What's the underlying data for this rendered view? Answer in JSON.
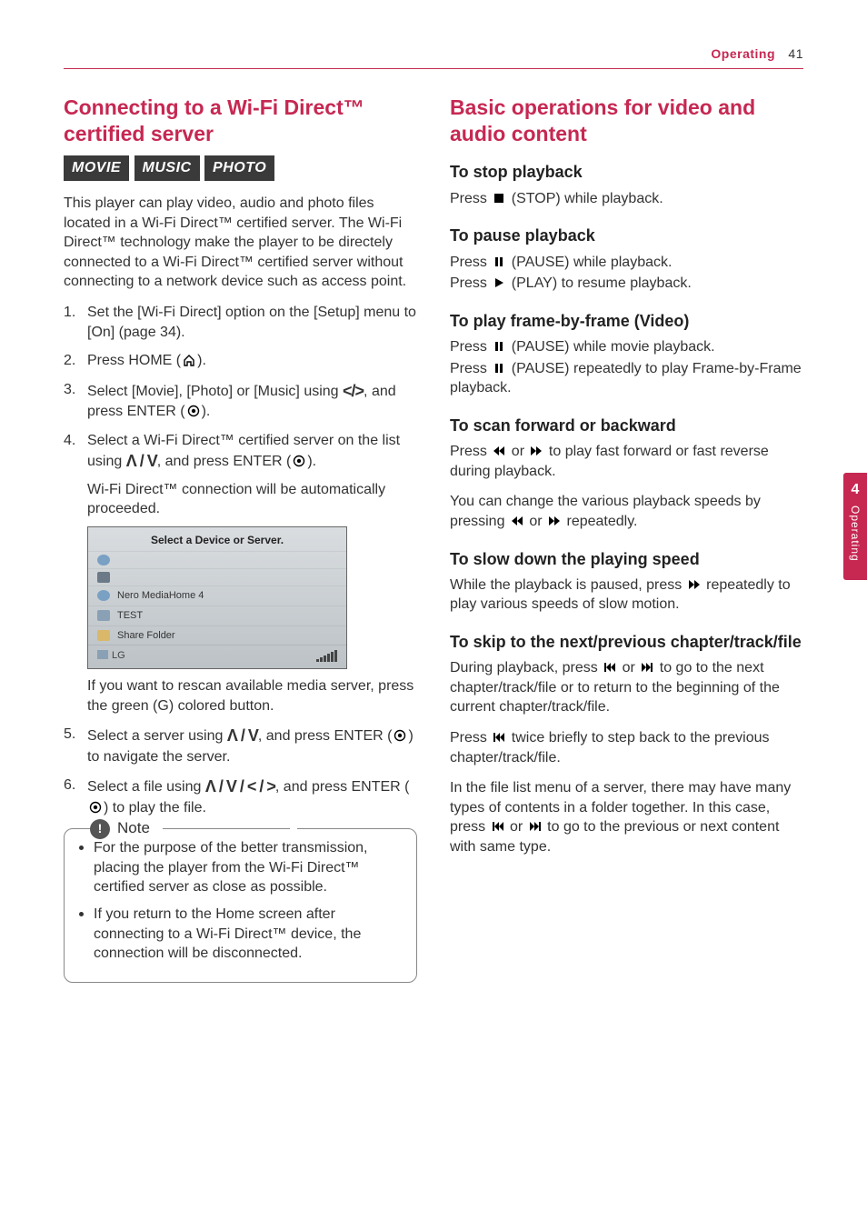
{
  "header": {
    "section": "Operating",
    "page": "41"
  },
  "sidetab": {
    "number": "4",
    "label": "Operating"
  },
  "left": {
    "title": "Connecting to a Wi-Fi Direct™ certified server",
    "chips": [
      "MOVIE",
      "MUSIC",
      "PHOTO"
    ],
    "intro": "This player can play video, audio and photo files located in a Wi-Fi Direct™ certified server. The Wi-Fi Direct™ technology make the player to be directely connected to a Wi-Fi Direct™ certified server without connecting to a network device such as access point.",
    "steps": {
      "s1": "Set the [Wi-Fi Direct] option on the [Setup] menu to [On] (page 34).",
      "s2a": "Press HOME (",
      "s2b": ").",
      "s3a": "Select [Movie], [Photo] or [Music] using ",
      "s3b": ", and press ENTER (",
      "s3c": ").",
      "s4a": "Select a Wi-Fi Direct™ certified server on the list using ",
      "s4b": ", and press ENTER (",
      "s4c": ").",
      "s4_sub": "Wi-Fi Direct™ connection will be automatically proceeded.",
      "s4_after": "If you want to rescan available media server, press the green (G) colored button.",
      "s5a": "Select a server using ",
      "s5b": ", and press ENTER (",
      "s5c": ") to navigate the server.",
      "s6a": "Select a file using ",
      "s6b": ", and press ENTER (",
      "s6c": ") to play the file."
    },
    "screenshot": {
      "title": "Select a Device or Server.",
      "rows": [
        "",
        "",
        "Nero MediaHome 4",
        "TEST",
        "Share Folder"
      ],
      "footer_left": "LG"
    },
    "note": {
      "label": "Note",
      "items": [
        "For the purpose of the better transmission, placing the player from the Wi-Fi Direct™ certified server as close as possible.",
        "If you return to the Home screen after connecting to a Wi-Fi Direct™ device, the connection will be disconnected."
      ]
    }
  },
  "right": {
    "title": "Basic operations for video and audio content",
    "stop": {
      "h": "To stop playback",
      "p1a": "Press ",
      "p1b": " (STOP) while playback."
    },
    "pause": {
      "h": "To pause playback",
      "p1a": "Press ",
      "p1b": " (PAUSE) while playback.",
      "p2a": "Press ",
      "p2b": " (PLAY) to resume playback."
    },
    "frame": {
      "h": "To play frame-by-frame (Video)",
      "p1a": "Press ",
      "p1b": " (PAUSE) while movie playback.",
      "p2a": "Press ",
      "p2b": " (PAUSE) repeatedly to play Frame-by-Frame playback."
    },
    "scan": {
      "h": "To scan forward or backward",
      "p1a": "Press ",
      "p1b": " or ",
      "p1c": " to play fast forward or fast reverse during playback.",
      "p2a": "You can change the various playback speeds by pressing ",
      "p2b": " or ",
      "p2c": " repeatedly."
    },
    "slow": {
      "h": "To slow down the playing speed",
      "p1a": "While the playback is paused, press ",
      "p1b": " repeatedly to play various speeds of slow motion."
    },
    "skip": {
      "h": "To skip to the next/previous chapter/track/file",
      "p1a": "During playback, press ",
      "p1b": " or ",
      "p1c": " to go to the next chapter/track/file or to return to the beginning of the current chapter/track/file.",
      "p2a": "Press ",
      "p2b": " twice briefly to step back to the previous chapter/track/file.",
      "p3a": "In the file list menu of a server, there may have many types of contents in a folder together. In this case, press ",
      "p3b": " or ",
      "p3c": " to go to the previous or next content with same type."
    }
  },
  "sym": {
    "left_right": "</>",
    "up_down": "Λ / V",
    "up_down_left_right": "Λ / V / < / >"
  }
}
